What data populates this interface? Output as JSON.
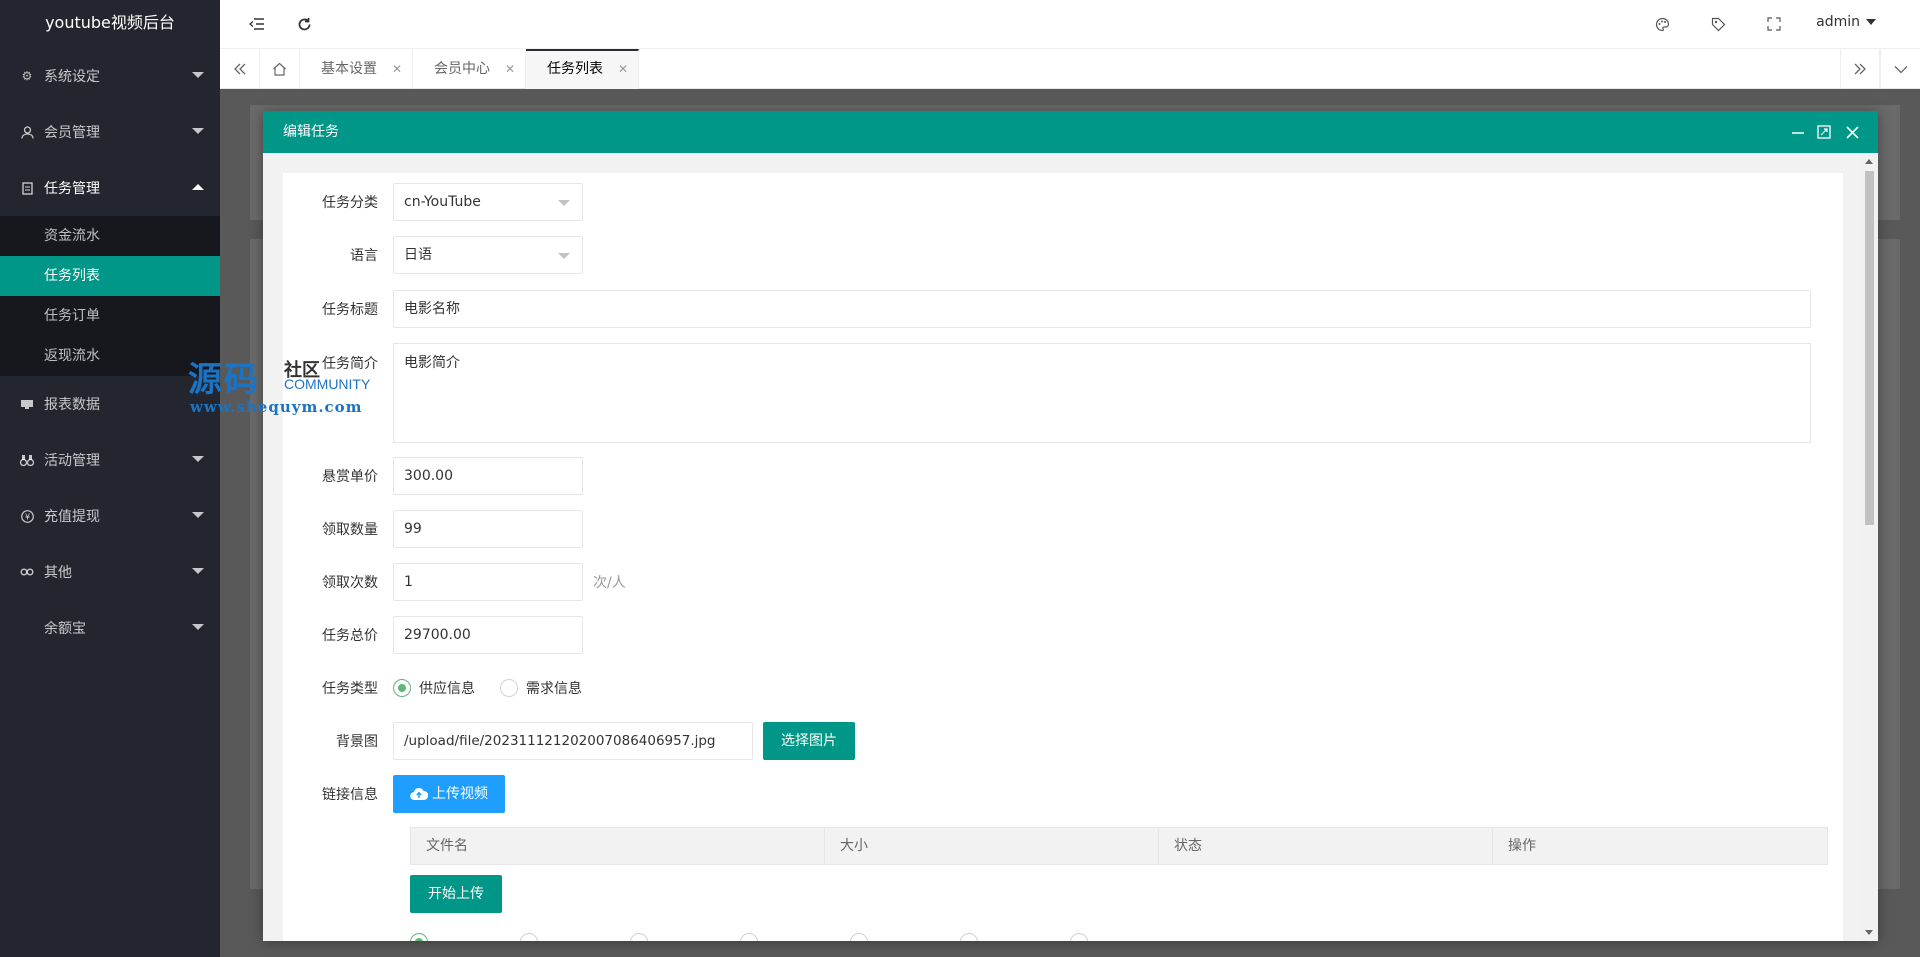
{
  "app": {
    "title": "youtube视频后台"
  },
  "sidebar": {
    "items": [
      {
        "label": "系统设定",
        "icon": "gear-icon"
      },
      {
        "label": "会员管理",
        "icon": "user-icon"
      },
      {
        "label": "任务管理",
        "icon": "doc-icon",
        "expanded": true,
        "children": [
          {
            "label": "资金流水"
          },
          {
            "label": "任务列表",
            "active": true
          },
          {
            "label": "任务订单"
          },
          {
            "label": "返现流水"
          }
        ]
      },
      {
        "label": "报表数据",
        "icon": "report-icon"
      },
      {
        "label": "活动管理",
        "icon": "binocular-icon"
      },
      {
        "label": "充值提现",
        "icon": "yen-icon"
      },
      {
        "label": "其他",
        "icon": "link-icon"
      },
      {
        "label": "余额宝",
        "icon": ""
      }
    ]
  },
  "watermark": {
    "big": "源码",
    "small": "社区",
    "community": "COMMUNITY",
    "url": "www.shequym.com"
  },
  "header": {
    "user": "admin"
  },
  "tabs": [
    {
      "label": "基本设置"
    },
    {
      "label": "会员中心"
    },
    {
      "label": "任务列表",
      "active": true
    }
  ],
  "modal": {
    "title": "编辑任务",
    "fields": {
      "category": {
        "label": "任务分类",
        "value": "cn-YouTube"
      },
      "language": {
        "label": "语言",
        "value": "日语"
      },
      "task_title": {
        "label": "任务标题",
        "value": "电影名称"
      },
      "intro": {
        "label": "任务简介",
        "value": "电影简介"
      },
      "reward": {
        "label": "悬赏单价",
        "value": "300.00"
      },
      "quantity": {
        "label": "领取数量",
        "value": "99"
      },
      "times": {
        "label": "领取次数",
        "value": "1",
        "unit": "次/人"
      },
      "total": {
        "label": "任务总价",
        "value": "29700.00"
      },
      "task_type": {
        "label": "任务类型",
        "options": [
          "供应信息",
          "需求信息"
        ],
        "selected": "供应信息"
      },
      "background": {
        "label": "背景图",
        "value": "/upload/file/20231112120200708640695​7.jpg",
        "button": "选择图片"
      },
      "link": {
        "label": "链接信息",
        "upload_button": "上传视频",
        "start_button": "开始上传"
      }
    },
    "upload_table": {
      "columns": [
        "文件名",
        "大小",
        "状态",
        "操作"
      ]
    }
  }
}
